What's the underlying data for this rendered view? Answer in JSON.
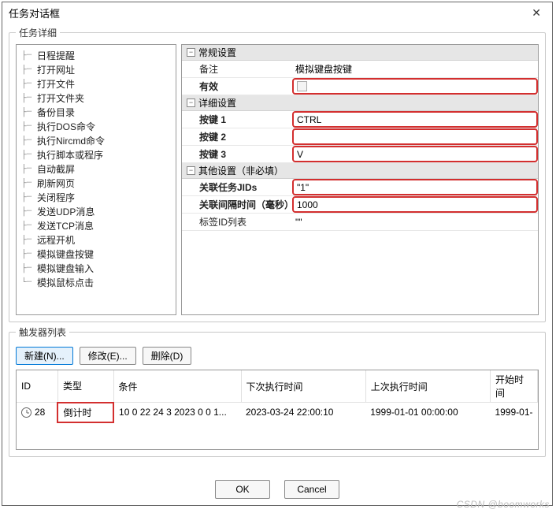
{
  "dialog": {
    "title": "任务对话框"
  },
  "details": {
    "legend": "任务详细",
    "tree_items": [
      "日程提醒",
      "打开网址",
      "打开文件",
      "打开文件夹",
      "备份目录",
      "执行DOS命令",
      "执行Nircmd命令",
      "执行脚本或程序",
      "自动截屏",
      "刷新网页",
      "关闭程序",
      "发送UDP消息",
      "发送TCP消息",
      "远程开机",
      "模拟键盘按键",
      "模拟键盘输入",
      "模拟鼠标点击"
    ],
    "general": {
      "section_label": "常规设置",
      "remark_label": "备注",
      "remark_value": "模拟键盘按键",
      "enabled_label": "有效"
    },
    "detail": {
      "section_label": "详细设置",
      "key1_label": "按键 1",
      "key1_value": "CTRL",
      "key2_label": "按键 2",
      "key2_value": "",
      "key3_label": "按键 3",
      "key3_value": "V"
    },
    "other": {
      "section_label": "其他设置（非必填）",
      "jids_label": "关联任务JIDs",
      "jids_value": "\"1\"",
      "interval_label": "关联间隔时间（毫秒）",
      "interval_value": "1000",
      "tagids_label": "标签ID列表",
      "tagids_value": "\"\""
    }
  },
  "triggers": {
    "legend": "触发器列表",
    "buttons": {
      "new": "新建(N)...",
      "edit": "修改(E)...",
      "delete": "删除(D)"
    },
    "columns": {
      "id": "ID",
      "type": "类型",
      "cond": "条件",
      "next": "下次执行时间",
      "last": "上次执行时间",
      "start": "开始时间"
    },
    "row": {
      "id": "28",
      "type": "倒计时",
      "cond": "10 0 22 24 3 2023 0 0 1...",
      "next": "2023-03-24 22:00:10",
      "last": "1999-01-01 00:00:00",
      "start": "1999-01-"
    }
  },
  "footer": {
    "ok": "OK",
    "cancel": "Cancel"
  },
  "watermark": "CSDN @boomworks"
}
